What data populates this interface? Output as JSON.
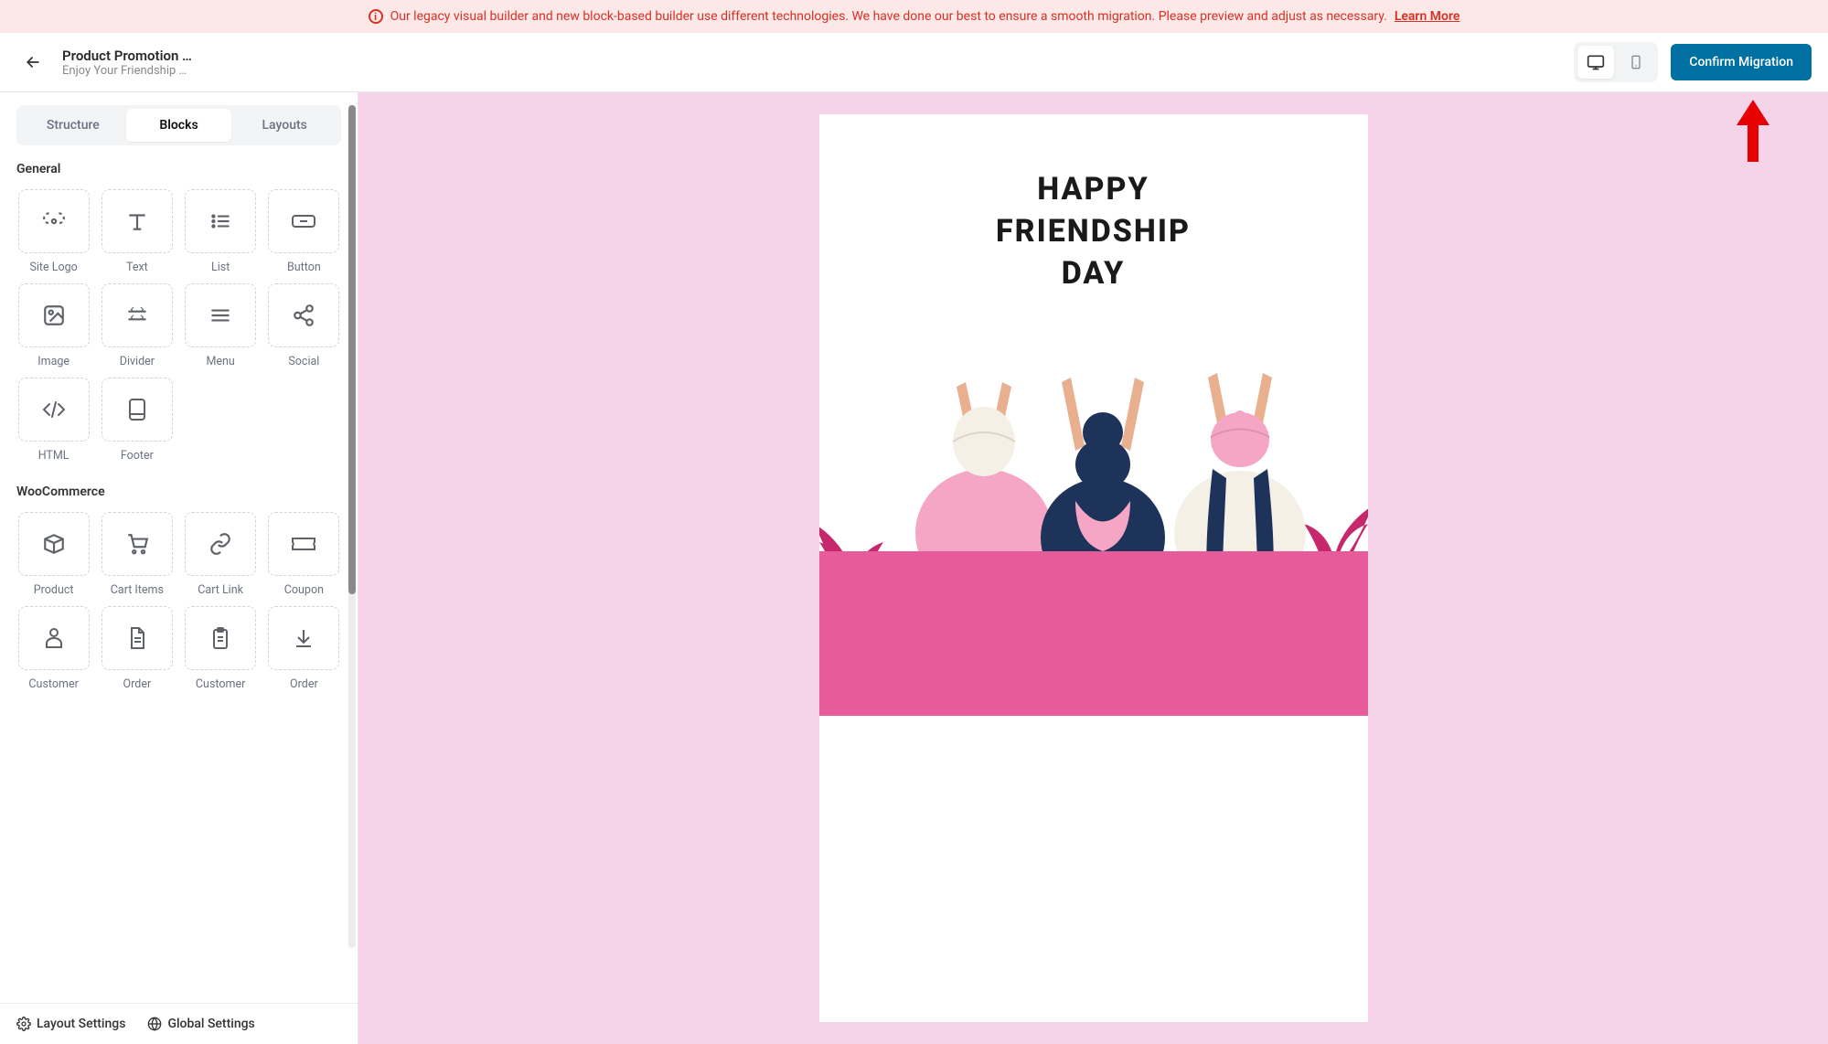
{
  "banner": {
    "text": "Our legacy visual builder and new block-based builder use different technologies. We have done our best to ensure a smooth migration. Please preview and adjust as necessary.",
    "link_label": "Learn More"
  },
  "header": {
    "title": "Product Promotion …",
    "subtitle": "Enjoy Your Friendship …",
    "confirm_label": "Confirm Migration"
  },
  "tabs": {
    "structure": "Structure",
    "blocks": "Blocks",
    "layouts": "Layouts"
  },
  "sections": {
    "general": "General",
    "woocommerce": "WooCommerce"
  },
  "blocks": {
    "general": [
      {
        "id": "site-logo",
        "label": "Site Logo"
      },
      {
        "id": "text",
        "label": "Text"
      },
      {
        "id": "list",
        "label": "List"
      },
      {
        "id": "button",
        "label": "Button"
      },
      {
        "id": "image",
        "label": "Image"
      },
      {
        "id": "divider",
        "label": "Divider"
      },
      {
        "id": "menu",
        "label": "Menu"
      },
      {
        "id": "social",
        "label": "Social"
      },
      {
        "id": "html",
        "label": "HTML"
      },
      {
        "id": "footer",
        "label": "Footer"
      }
    ],
    "woocommerce": [
      {
        "id": "product",
        "label": "Product"
      },
      {
        "id": "cart-items",
        "label": "Cart Items"
      },
      {
        "id": "cart-link",
        "label": "Cart Link"
      },
      {
        "id": "coupon",
        "label": "Coupon"
      },
      {
        "id": "customer",
        "label": "Customer"
      },
      {
        "id": "order",
        "label": "Order"
      },
      {
        "id": "customer2",
        "label": "Customer"
      },
      {
        "id": "order2",
        "label": "Order"
      }
    ]
  },
  "footer": {
    "layout_settings": "Layout Settings",
    "global_settings": "Global Settings"
  },
  "canvas": {
    "heading_line1": "HAPPY",
    "heading_line2": "FRIENDSHIP",
    "heading_line3": "DAY"
  },
  "colors": {
    "accent": "#0070a3",
    "banner_bg": "#fce8e6",
    "banner_text": "#d93025",
    "canvas_bg": "#f5d3e8",
    "ground": "#e85b9a",
    "leaf": "#c7286c",
    "arrow": "#e60000"
  }
}
